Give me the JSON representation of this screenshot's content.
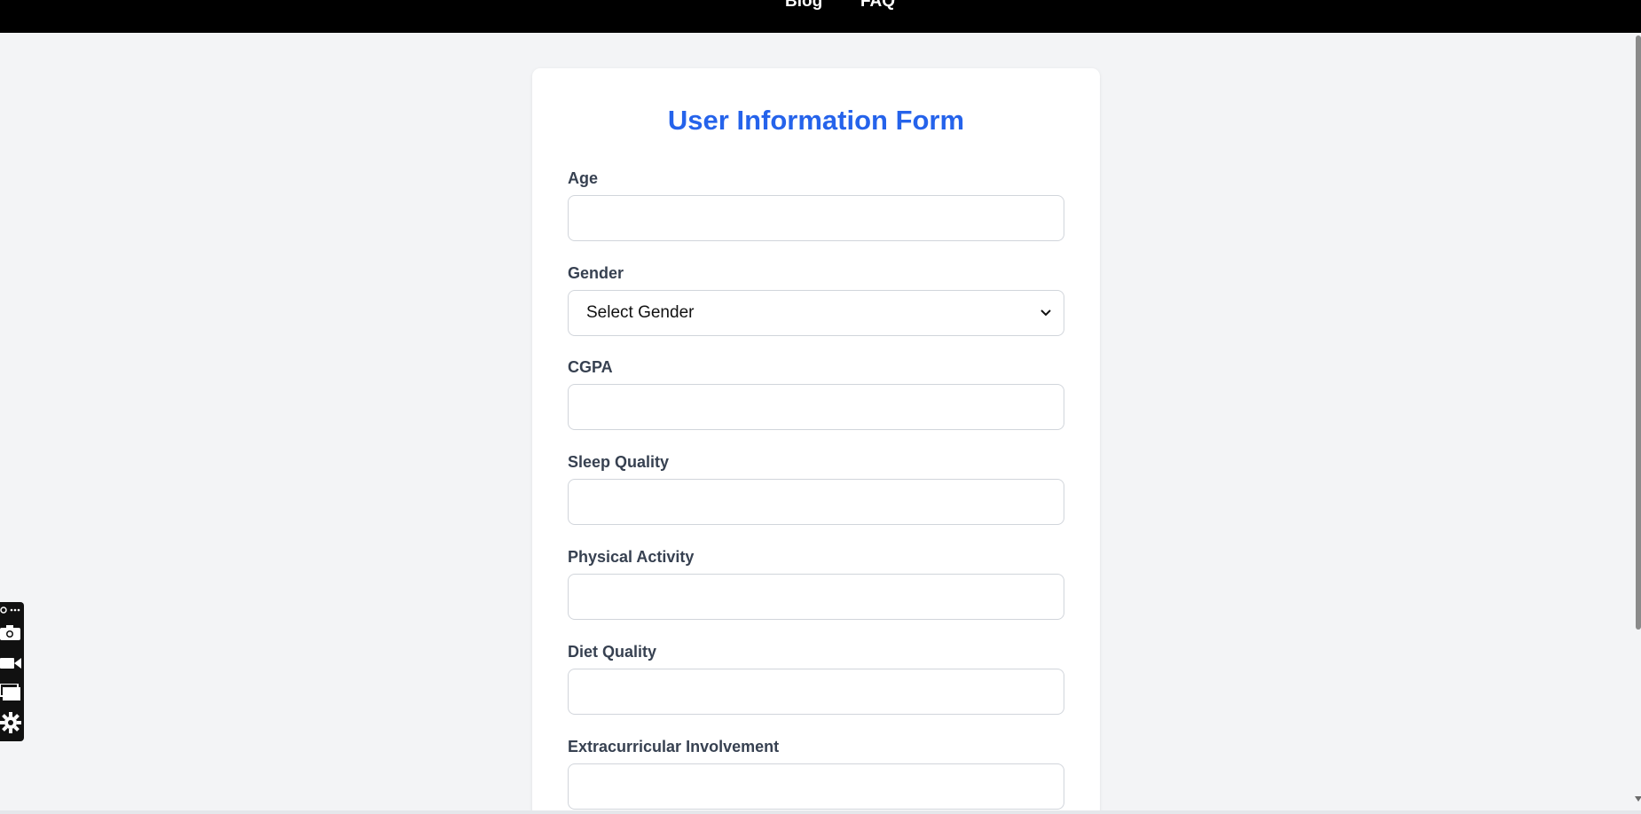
{
  "nav": {
    "items": [
      {
        "label": "Blog"
      },
      {
        "label": "FAQ"
      }
    ]
  },
  "form": {
    "title": "User Information Form",
    "fields": [
      {
        "label": "Age",
        "value": "",
        "type": "input"
      },
      {
        "label": "Gender",
        "value": "Select Gender",
        "type": "select"
      },
      {
        "label": "CGPA",
        "value": "",
        "type": "input"
      },
      {
        "label": "Sleep Quality",
        "value": "",
        "type": "input"
      },
      {
        "label": "Physical Activity",
        "value": "",
        "type": "input"
      },
      {
        "label": "Diet Quality",
        "value": "",
        "type": "input"
      },
      {
        "label": "Extracurricular Involvement",
        "value": "",
        "type": "input"
      }
    ]
  },
  "tool_panel": {
    "icons": [
      "link-icon",
      "more-icon",
      "camera-icon",
      "video-icon",
      "window-icon",
      "gear-icon"
    ]
  },
  "colors": {
    "title": "#2563eb",
    "topbar": "#000000",
    "background": "#f3f4f6",
    "label": "#374151"
  }
}
